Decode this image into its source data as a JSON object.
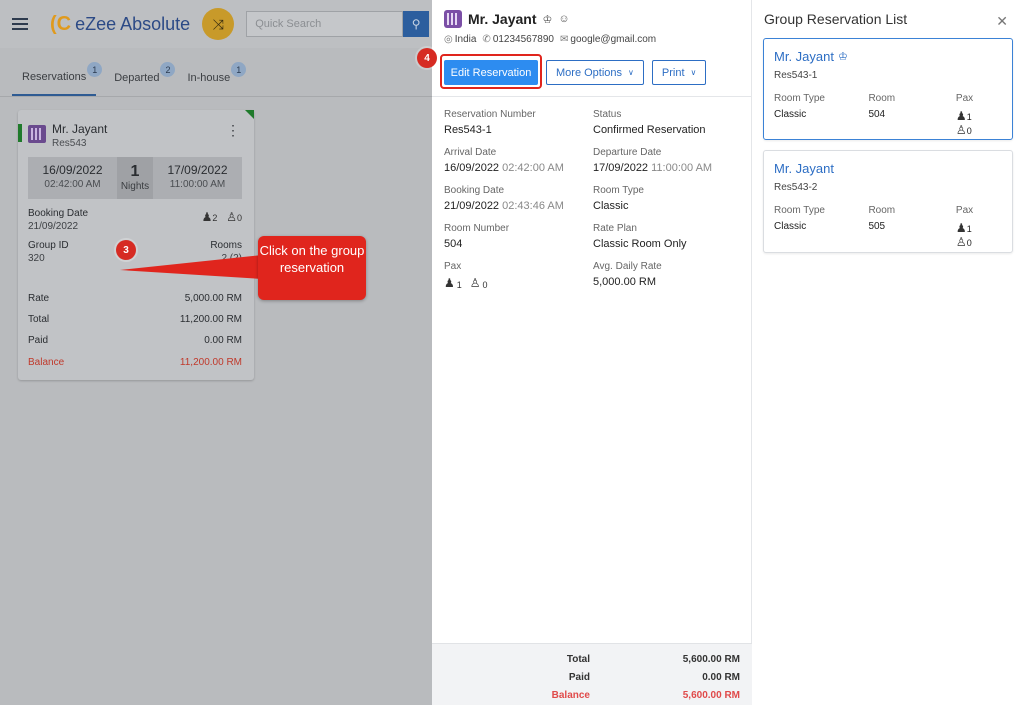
{
  "app": {
    "logo_text": "eZee Absolute",
    "search_placeholder": "Quick Search"
  },
  "tabs": [
    {
      "label": "Reservations",
      "count": "1"
    },
    {
      "label": "Departed",
      "count": "2"
    },
    {
      "label": "In-house",
      "count": "1"
    }
  ],
  "card": {
    "name": "Mr. Jayant",
    "code": "Res543",
    "arrival_date": "16/09/2022",
    "arrival_time": "02:42:00 AM",
    "nights": "1",
    "nights_label": "Nights",
    "departure_date": "17/09/2022",
    "departure_time": "11:00:00 AM",
    "booking_date_label": "Booking Date",
    "booking_date": "21/09/2022",
    "adults": "2",
    "children": "0",
    "group_id_label": "Group ID",
    "group_id": "320",
    "rooms_label": "Rooms",
    "rooms": "2 (2)",
    "rate_label": "Rate",
    "rate": "5,000.00 RM",
    "total_label": "Total",
    "total": "11,200.00 RM",
    "paid_label": "Paid",
    "paid": "0.00 RM",
    "balance_label": "Balance",
    "balance": "11,200.00 RM"
  },
  "annotations": {
    "step3": "3",
    "step4": "4",
    "callout_text": "Click on the group reservation"
  },
  "detail": {
    "name": "Mr. Jayant",
    "country": "India",
    "phone": "01234567890",
    "email": "google@gmail.com",
    "edit_button": "Edit Reservation",
    "more_options_button": "More Options",
    "print_button": "Print",
    "fields": {
      "reservation_number_label": "Reservation Number",
      "reservation_number": "Res543-1",
      "status_label": "Status",
      "status": "Confirmed Reservation",
      "arrival_label": "Arrival Date",
      "arrival_date": "16/09/2022",
      "arrival_time": "02:42:00 AM",
      "departure_label": "Departure Date",
      "departure_date": "17/09/2022",
      "departure_time": "11:00:00 AM",
      "booking_label": "Booking Date",
      "booking_date": "21/09/2022",
      "booking_time": "02:43:46 AM",
      "room_type_label": "Room Type",
      "room_type": "Classic",
      "room_number_label": "Room Number",
      "room_number": "504",
      "rate_plan_label": "Rate Plan",
      "rate_plan": "Classic Room Only",
      "pax_label": "Pax",
      "adults": "1",
      "children": "0",
      "adr_label": "Avg. Daily Rate",
      "adr": "5,000.00 RM"
    },
    "totals": {
      "total_label": "Total",
      "total": "5,600.00 RM",
      "paid_label": "Paid",
      "paid": "0.00 RM",
      "balance_label": "Balance",
      "balance": "5,600.00 RM"
    }
  },
  "group_list": {
    "title": "Group Reservation List",
    "items": [
      {
        "name": "Mr. Jayant",
        "code": "Res543-1",
        "room_type_label": "Room Type",
        "room_type": "Classic",
        "room_label": "Room",
        "room": "504",
        "pax_label": "Pax",
        "adults": "1",
        "children": "0"
      },
      {
        "name": "Mr. Jayant",
        "code": "Res543-2",
        "room_type_label": "Room Type",
        "room_type": "Classic",
        "room_label": "Room",
        "room": "505",
        "pax_label": "Pax",
        "adults": "1",
        "children": "0"
      }
    ]
  },
  "colors": {
    "primary": "#2d8cf0",
    "link": "#2d6ec4",
    "annotation_red": "#e0251d",
    "balance_red": "#e04a4a"
  }
}
